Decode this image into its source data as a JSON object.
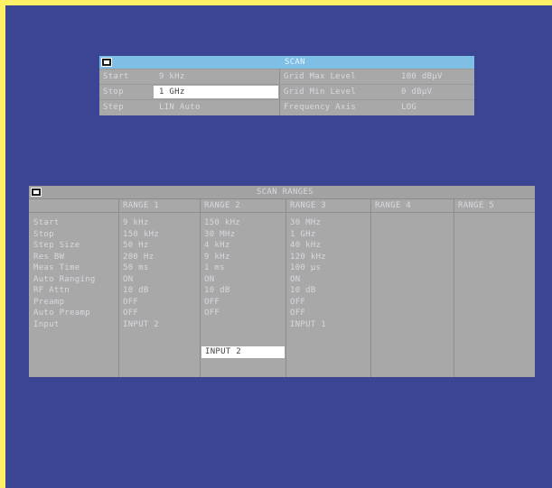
{
  "scan": {
    "title": "SCAN",
    "rows": [
      {
        "label": "Start",
        "value": "9 kHz",
        "right_label": "Grid Max Level",
        "right_value": "100 dBµV"
      },
      {
        "label": "Stop",
        "value": "1 GHz",
        "right_label": "Grid Min Level",
        "right_value": "0 dBµV"
      },
      {
        "label": "Step",
        "value": "LIN Auto",
        "right_label": "Frequency Axis",
        "right_value": "LOG"
      }
    ]
  },
  "ranges": {
    "title": "SCAN RANGES",
    "headers": [
      "RANGE 1",
      "RANGE 2",
      "RANGE 3",
      "RANGE 4",
      "RANGE 5"
    ],
    "row_labels": [
      "Start",
      "Stop",
      "Step Size",
      "Res BW",
      "Meas Time",
      "Auto Ranging",
      "RF Attn",
      "Preamp",
      "Auto Preamp",
      "Input"
    ],
    "columns": [
      [
        "9 kHz",
        "150 kHz",
        "50 Hz",
        "200 Hz",
        "50 ms",
        "ON",
        "10 dB",
        "OFF",
        "OFF",
        "INPUT 2"
      ],
      [
        "150 kHz",
        "30 MHz",
        "4 kHz",
        "9 kHz",
        "1 ms",
        "ON",
        "10 dB",
        "OFF",
        "OFF",
        "INPUT 2"
      ],
      [
        "30 MHz",
        "1 GHz",
        "40 kHz",
        "120 kHz",
        "100 µs",
        "ON",
        "10 dB",
        "OFF",
        "OFF",
        "INPUT 1"
      ]
    ]
  }
}
